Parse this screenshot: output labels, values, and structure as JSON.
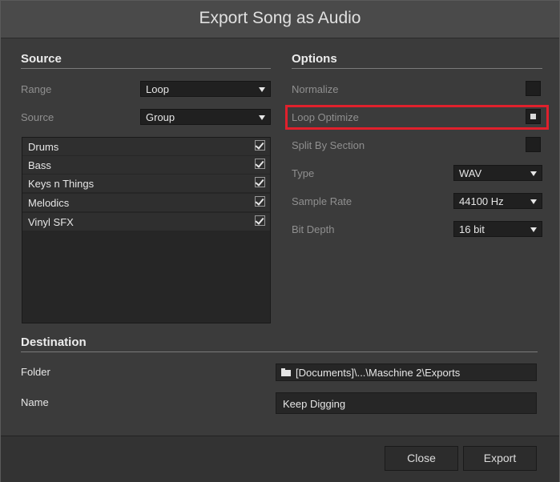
{
  "dialog": {
    "title": "Export Song as Audio"
  },
  "source": {
    "heading": "Source",
    "range_label": "Range",
    "range_value": "Loop",
    "source_label": "Source",
    "source_value": "Group",
    "groups": [
      {
        "name": "Drums",
        "checked": true
      },
      {
        "name": "Bass",
        "checked": true
      },
      {
        "name": "Keys n Things",
        "checked": true
      },
      {
        "name": "Melodics",
        "checked": true
      },
      {
        "name": "Vinyl SFX",
        "checked": true
      }
    ]
  },
  "options": {
    "heading": "Options",
    "normalize_label": "Normalize",
    "normalize_checked": false,
    "loop_optimize_label": "Loop Optimize",
    "loop_optimize_checked": true,
    "split_label": "Split By Section",
    "split_checked": false,
    "type_label": "Type",
    "type_value": "WAV",
    "sample_rate_label": "Sample Rate",
    "sample_rate_value": "44100 Hz",
    "bit_depth_label": "Bit Depth",
    "bit_depth_value": "16 bit"
  },
  "destination": {
    "heading": "Destination",
    "folder_label": "Folder",
    "folder_value": "[Documents]\\...\\Maschine 2\\Exports",
    "name_label": "Name",
    "name_value": "Keep Digging"
  },
  "footer": {
    "close_label": "Close",
    "export_label": "Export"
  },
  "colors": {
    "highlight": "#e0202c"
  }
}
